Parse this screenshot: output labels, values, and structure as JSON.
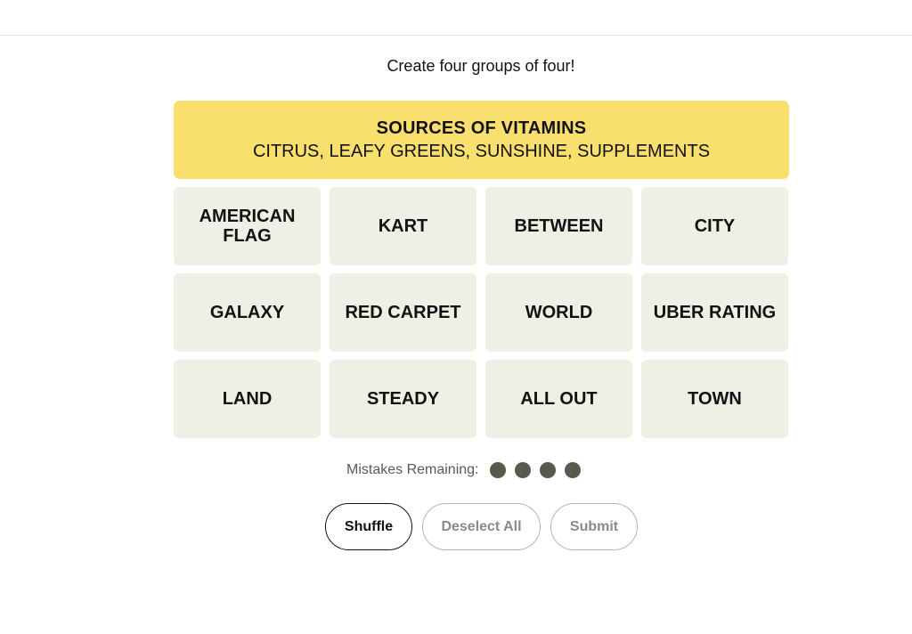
{
  "instructions": "Create four groups of four!",
  "solved_group": {
    "title": "SOURCES OF VITAMINS",
    "members": "CITRUS, LEAFY GREENS, SUNSHINE, SUPPLEMENTS",
    "color": "#f9df6d"
  },
  "tiles": [
    "AMERICAN FLAG",
    "KART",
    "BETWEEN",
    "CITY",
    "GALAXY",
    "RED CARPET",
    "WORLD",
    "UBER RATING",
    "LAND",
    "STEADY",
    "ALL OUT",
    "TOWN"
  ],
  "mistakes": {
    "label": "Mistakes Remaining:",
    "remaining": 4
  },
  "buttons": {
    "shuffle": "Shuffle",
    "deselect_all": "Deselect All",
    "submit": "Submit"
  }
}
